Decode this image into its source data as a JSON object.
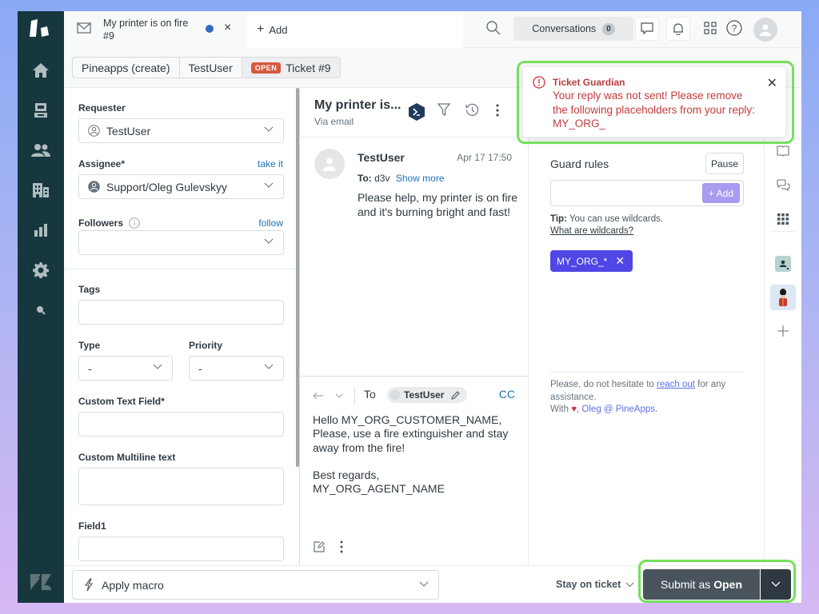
{
  "nav": {
    "items": [
      {
        "name": "home",
        "icon": "home-icon"
      },
      {
        "name": "views",
        "icon": "inbox-icon"
      },
      {
        "name": "customers",
        "icon": "users-icon"
      },
      {
        "name": "organizations",
        "icon": "building-icon"
      },
      {
        "name": "reporting",
        "icon": "bar-chart-icon"
      },
      {
        "name": "admin",
        "icon": "gear-icon"
      },
      {
        "name": "search",
        "icon": "search-icon"
      }
    ]
  },
  "topbar": {
    "tab_title": "My printer is on fire #9",
    "add_label": "Add",
    "conversations_label": "Conversations",
    "conversations_count": "0"
  },
  "breadcrumb": {
    "items": [
      "Pineapps (create)",
      "TestUser"
    ],
    "status_badge": "OPEN",
    "ticket": "Ticket #9"
  },
  "form": {
    "requester_label": "Requester",
    "requester_value": "TestUser",
    "assignee_label": "Assignee*",
    "assignee_link": "take it",
    "assignee_value": "Support/Oleg Gulevskyy",
    "followers_label": "Followers",
    "followers_link": "follow",
    "followers_value": "",
    "tags_label": "Tags",
    "tags_value": "",
    "type_label": "Type",
    "type_value": "-",
    "priority_label": "Priority",
    "priority_value": "-",
    "custom_text_label": "Custom Text Field*",
    "custom_text_value": "",
    "custom_multiline_label": "Custom Multiline text",
    "custom_multiline_value": "",
    "field1_label": "Field1",
    "field1_value": ""
  },
  "conversation": {
    "title": "My printer is...",
    "channel": "Via email",
    "message": {
      "author": "TestUser",
      "time": "Apr 17 17:50",
      "to_label": "To:",
      "to_value": "d3v",
      "show_more": "Show more",
      "body": "Please help, my printer is on fire and it's burning bright and fast!"
    },
    "reply": {
      "to_label": "To",
      "recipient": "TestUser",
      "cc_label": "CC",
      "text": "Hello MY_ORG_CUSTOMER_NAME,\nPlease, use a fire extinguisher and stay away from the fire!\n\nBest regards,\nMY_ORG_AGENT_NAME"
    }
  },
  "toast": {
    "title": "Ticket Guardian",
    "message": "Your reply was not sent! Please remove the following placeholders from your reply: MY_ORG_"
  },
  "guardian": {
    "title": "Guard rules",
    "pause_label": "Pause",
    "input_value": "",
    "add_label": "+ Add",
    "tip_bold": "Tip:",
    "tip_text": " You can use wildcards.",
    "tip_link": "What are wildcards?",
    "rules": [
      "MY_ORG_*"
    ],
    "support_pre": "Please, do not hesitate to ",
    "support_link": "reach out",
    "support_post": " for any assistance.",
    "with_label": "With ",
    "signature": "Oleg @ PineApps",
    "accent_color": "#5046e5"
  },
  "bottom": {
    "macro_label": "Apply macro",
    "stay_label": "Stay on ticket",
    "submit_prefix": "Submit as",
    "submit_status": "Open"
  }
}
